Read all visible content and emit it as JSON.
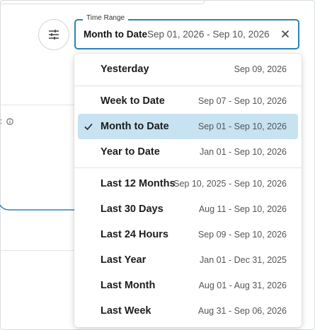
{
  "time_range": {
    "legend": "Time Range",
    "selected_label": "Month to Date",
    "selected_range": "Sep 01, 2026 - Sep 10, 2026"
  },
  "left_panel": {
    "info_prefix": ":"
  },
  "options": [
    {
      "label": "Yesterday",
      "range": "Sep 09, 2026",
      "selected": false
    },
    {
      "label": "Week to Date",
      "range": "Sep 07 - Sep 10, 2026",
      "selected": false
    },
    {
      "label": "Month to Date",
      "range": "Sep 01 - Sep 10, 2026",
      "selected": true
    },
    {
      "label": "Year to Date",
      "range": "Jan 01 - Sep 10, 2026",
      "selected": false
    },
    {
      "label": "Last 12 Months",
      "range": "Sep 10, 2025 - Sep 10, 2026",
      "selected": false
    },
    {
      "label": "Last 30 Days",
      "range": "Aug 11 - Sep 10, 2026",
      "selected": false
    },
    {
      "label": "Last 24 Hours",
      "range": "Sep 09 - Sep 10, 2026",
      "selected": false
    },
    {
      "label": "Last Year",
      "range": "Jan 01 - Dec 31, 2025",
      "selected": false
    },
    {
      "label": "Last Month",
      "range": "Aug 01 - Aug 31, 2026",
      "selected": false
    },
    {
      "label": "Last Week",
      "range": "Aug 31 - Sep 06, 2026",
      "selected": false
    }
  ],
  "colors": {
    "accent": "#2b83b5",
    "selected_bg": "#c7e2f0",
    "chart_line": "#2b83b5"
  },
  "icons": {
    "filter": "sliders-icon",
    "clear": "close-icon",
    "check": "check-icon",
    "info": "info-icon"
  }
}
